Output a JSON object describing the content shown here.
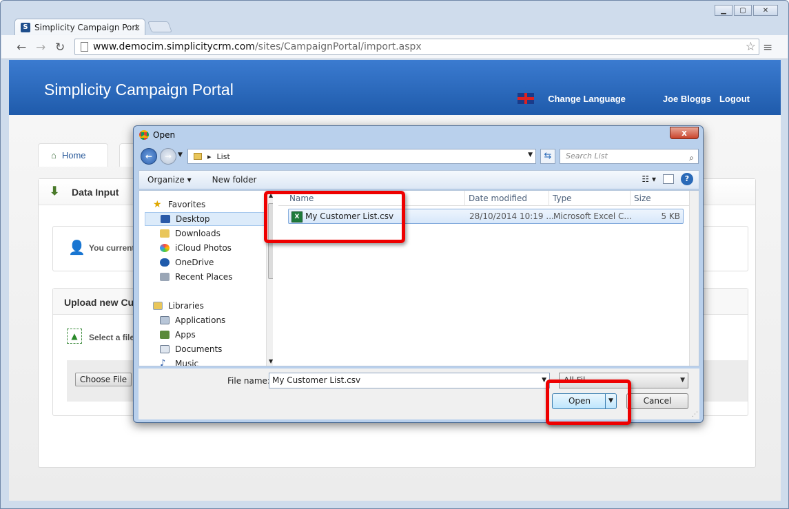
{
  "browser": {
    "tab_title": "Simplicity Campaign Port",
    "tab_close": "×",
    "favicon": "S",
    "url_domain": "www.democim.simplicitycrm.com",
    "url_path": "/sites/CampaignPortal/import.aspx",
    "win_min": "▁",
    "win_max": "▢",
    "win_close": "✕"
  },
  "portal": {
    "title": "Simplicity Campaign Portal",
    "change_language": "Change Language",
    "user": "Joe Bloggs",
    "logout": "Logout",
    "tabs": [
      {
        "label": "Home"
      }
    ],
    "section_title": "Data Input",
    "user_status": "You current",
    "upload_title": "Upload new Cu",
    "select_file": "Select a file",
    "choose_file": "Choose File"
  },
  "dialog": {
    "title": "Open",
    "close_label": "x",
    "path_arrow": "▸",
    "path": "List",
    "search_placeholder": "Search List",
    "organize": "Organize ▾",
    "new_folder": "New folder",
    "nav": {
      "favorites": "Favorites",
      "desktop": "Desktop",
      "downloads": "Downloads",
      "icloud": "iCloud Photos",
      "onedrive": "OneDrive",
      "recent": "Recent Places",
      "libraries": "Libraries",
      "applications": "Applications",
      "apps": "Apps",
      "documents": "Documents",
      "music": "Music"
    },
    "columns": {
      "name": "Name",
      "date": "Date modified",
      "type": "Type",
      "size": "Size"
    },
    "file": {
      "name": "My Customer List.csv",
      "date": "28/10/2014 10:19 ...",
      "type": "Microsoft Excel C...",
      "size": "5 KB"
    },
    "file_name_label": "File name:",
    "file_name_value": "My Customer List.csv",
    "file_type_value": "All Fil...",
    "open_button": "Open",
    "cancel_button": "Cancel"
  },
  "colors": {
    "banner": "#1f5bab",
    "highlight": "#ee0000",
    "accent": "#2a6ab8"
  }
}
